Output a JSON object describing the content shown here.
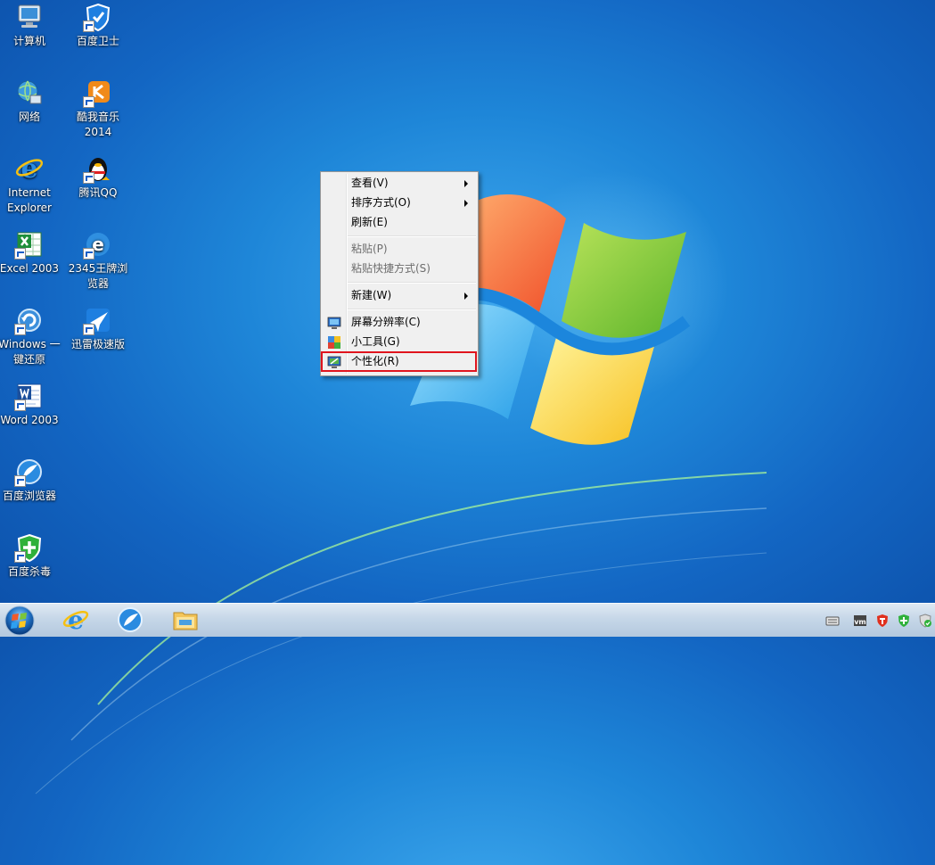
{
  "desktop": {
    "icons": [
      {
        "label": "计算机"
      },
      {
        "label": "百度卫士"
      },
      {
        "label": "网络"
      },
      {
        "label": "酷我音乐",
        "label2": "2014"
      },
      {
        "label": "Internet",
        "label2": "Explorer"
      },
      {
        "label": "腾讯QQ"
      },
      {
        "label": "Excel 2003"
      },
      {
        "label": "2345王牌浏",
        "label2": "览器"
      },
      {
        "label": "Windows 一",
        "label2": "键还原"
      },
      {
        "label": "迅雷极速版"
      },
      {
        "label": "Word 2003"
      },
      {
        "label": "百度浏览器"
      },
      {
        "label": "百度杀毒"
      }
    ]
  },
  "context_menu": {
    "items": [
      {
        "label": "查看(V)",
        "submenu": true
      },
      {
        "label": "排序方式(O)",
        "submenu": true
      },
      {
        "label": "刷新(E)"
      },
      {
        "label": "粘贴(P)",
        "disabled": true
      },
      {
        "label": "粘贴快捷方式(S)",
        "disabled": true
      },
      {
        "label": "新建(W)",
        "submenu": true
      },
      {
        "label": "屏幕分辨率(C)",
        "icon": "screen-resolution-icon"
      },
      {
        "label": "小工具(G)",
        "icon": "gadgets-icon"
      },
      {
        "label": "个性化(R)",
        "icon": "personalize-icon",
        "highlighted": true
      }
    ]
  },
  "taskbar": {
    "pinned": [
      {
        "icon": "ie-icon"
      },
      {
        "icon": "browser-icon"
      },
      {
        "icon": "file-explorer-icon"
      }
    ],
    "tray": [
      {
        "icon": "keyboard-icon"
      },
      {
        "icon": "vmware-icon"
      },
      {
        "icon": "baidu-guard-tray-icon"
      },
      {
        "icon": "security-shield-icon"
      },
      {
        "icon": "network-status-icon"
      }
    ]
  },
  "colors": {
    "highlight_border": "#e0141e",
    "desktop_blue": "#1e86d8"
  }
}
